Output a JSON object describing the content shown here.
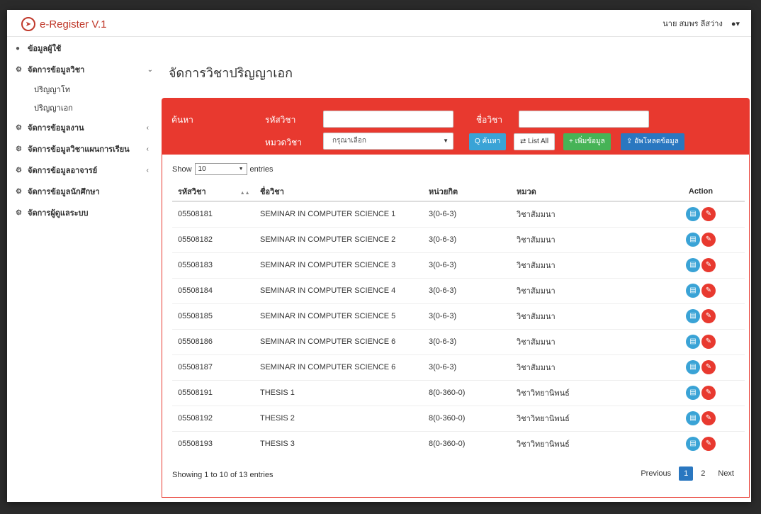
{
  "brand": {
    "title": "e-Register V.1"
  },
  "user": {
    "name": "นาย สมพร ลีสว่าง"
  },
  "sidebar": {
    "items": [
      {
        "label": "ข้อมูลผู้ใช้",
        "icon": "users-icon",
        "chevron": ""
      },
      {
        "label": "จัดการข้อมูลวิชา",
        "icon": "gears-icon",
        "chevron": "⌄"
      },
      {
        "label": "จัดการข้อมูลงาน",
        "icon": "gears-icon",
        "chevron": "‹"
      },
      {
        "label": "จัดการข้อมูลวิชาแผนการเรียน",
        "icon": "gears-icon",
        "chevron": "‹"
      },
      {
        "label": "จัดการข้อมูลอาจารย์",
        "icon": "gears-icon",
        "chevron": "‹"
      },
      {
        "label": "จัดการข้อมูลนักศึกษา",
        "icon": "gears-icon",
        "chevron": ""
      },
      {
        "label": "จัดการผู้ดูแลระบบ",
        "icon": "gears-icon",
        "chevron": ""
      }
    ],
    "subitems": [
      "ปริญญาโท",
      "ปริญญาเอก"
    ]
  },
  "main": {
    "title": "จัดการวิชาปริญญาเอก"
  },
  "search": {
    "heading": "ค้นหา",
    "code_label": "รหัสวิชา",
    "name_label": "ชื่อวิชา",
    "category_label": "หมวดวิชา",
    "category_value": "กรุณาเลือก",
    "search_btn": "Q ค้นหา",
    "listall_btn": "⇄ List All",
    "add_btn": "+ เพิ่มข้อมูล",
    "upload_btn": "⇪ อัพโหลดข้อมูล"
  },
  "table": {
    "show_label": "Show",
    "show_value": "10",
    "entries_label": "entries",
    "headers": {
      "code": "รหัสวิชา",
      "name": "ชื่อวิชา",
      "credit": "หน่วยกิต",
      "category": "หมวด",
      "action": "Action"
    },
    "rows": [
      {
        "code": "05508181",
        "name": "SEMINAR IN COMPUTER SCIENCE 1",
        "credit": "3(0-6-3)",
        "category": "วิชาสัมมนา"
      },
      {
        "code": "05508182",
        "name": "SEMINAR IN COMPUTER SCIENCE 2",
        "credit": "3(0-6-3)",
        "category": "วิชาสัมมนา"
      },
      {
        "code": "05508183",
        "name": "SEMINAR IN COMPUTER SCIENCE 3",
        "credit": "3(0-6-3)",
        "category": "วิชาสัมมนา"
      },
      {
        "code": "05508184",
        "name": "SEMINAR IN COMPUTER SCIENCE 4",
        "credit": "3(0-6-3)",
        "category": "วิชาสัมมนา"
      },
      {
        "code": "05508185",
        "name": "SEMINAR IN COMPUTER SCIENCE 5",
        "credit": "3(0-6-3)",
        "category": "วิชาสัมมนา"
      },
      {
        "code": "05508186",
        "name": "SEMINAR IN COMPUTER SCIENCE 6",
        "credit": "3(0-6-3)",
        "category": "วิชาสัมมนา"
      },
      {
        "code": "05508187",
        "name": "SEMINAR IN COMPUTER SCIENCE 6",
        "credit": "3(0-6-3)",
        "category": "วิชาสัมมนา"
      },
      {
        "code": "05508191",
        "name": "THESIS 1",
        "credit": "8(0-360-0)",
        "category": "วิชาวิทยานิพนธ์"
      },
      {
        "code": "05508192",
        "name": "THESIS 2",
        "credit": "8(0-360-0)",
        "category": "วิชาวิทยานิพนธ์"
      },
      {
        "code": "05508193",
        "name": "THESIS 3",
        "credit": "8(0-360-0)",
        "category": "วิชาวิทยานิพนธ์"
      }
    ],
    "info": "Showing 1 to 10 of 13 entries"
  },
  "pager": {
    "previous": "Previous",
    "page1": "1",
    "page2": "2",
    "next": "Next"
  }
}
